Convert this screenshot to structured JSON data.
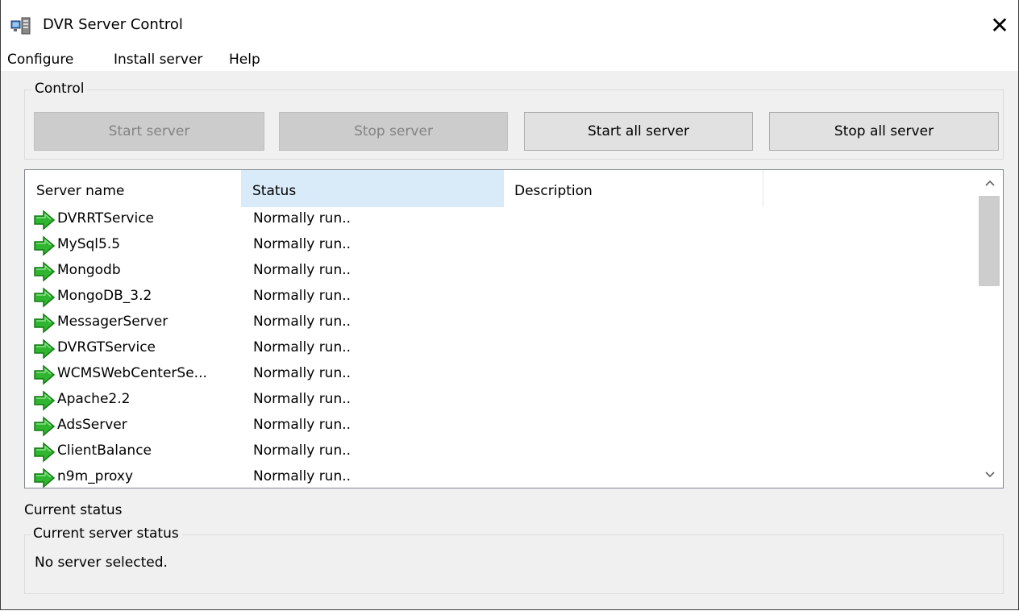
{
  "window": {
    "title": "DVR Server Control"
  },
  "menu": [
    "Configure",
    "Install server",
    "Help"
  ],
  "control": {
    "group_label": "Control",
    "buttons": {
      "start": "Start server",
      "stop": "Stop server",
      "start_all": "Start all server",
      "stop_all": "Stop all server"
    }
  },
  "list": {
    "columns": [
      "Server name",
      "Status",
      "Description"
    ],
    "rows": [
      {
        "name": "DVRRTService",
        "status": "Normally run.."
      },
      {
        "name": "MySql5.5",
        "status": "Normally run.."
      },
      {
        "name": "Mongodb",
        "status": "Normally run.."
      },
      {
        "name": "MongoDB_3.2",
        "status": "Normally run.."
      },
      {
        "name": "MessagerServer",
        "status": "Normally run.."
      },
      {
        "name": "DVRGTService",
        "status": "Normally run.."
      },
      {
        "name": "WCMSWebCenterSe...",
        "status": "Normally run.."
      },
      {
        "name": "Apache2.2",
        "status": "Normally run.."
      },
      {
        "name": "AdsServer",
        "status": "Normally run.."
      },
      {
        "name": "ClientBalance",
        "status": "Normally run.."
      },
      {
        "name": "n9m_proxy",
        "status": "Normally run.."
      }
    ]
  },
  "status": {
    "current_label": "Current status",
    "group_label": "Current server status",
    "message": "No server selected."
  },
  "icons": {
    "app": "dvr-server-icon",
    "close": "close-icon",
    "row": "green-arrow-icon"
  },
  "colors": {
    "arrow_green": "#2fb52f",
    "header_highlight": "#d9ebf9"
  }
}
